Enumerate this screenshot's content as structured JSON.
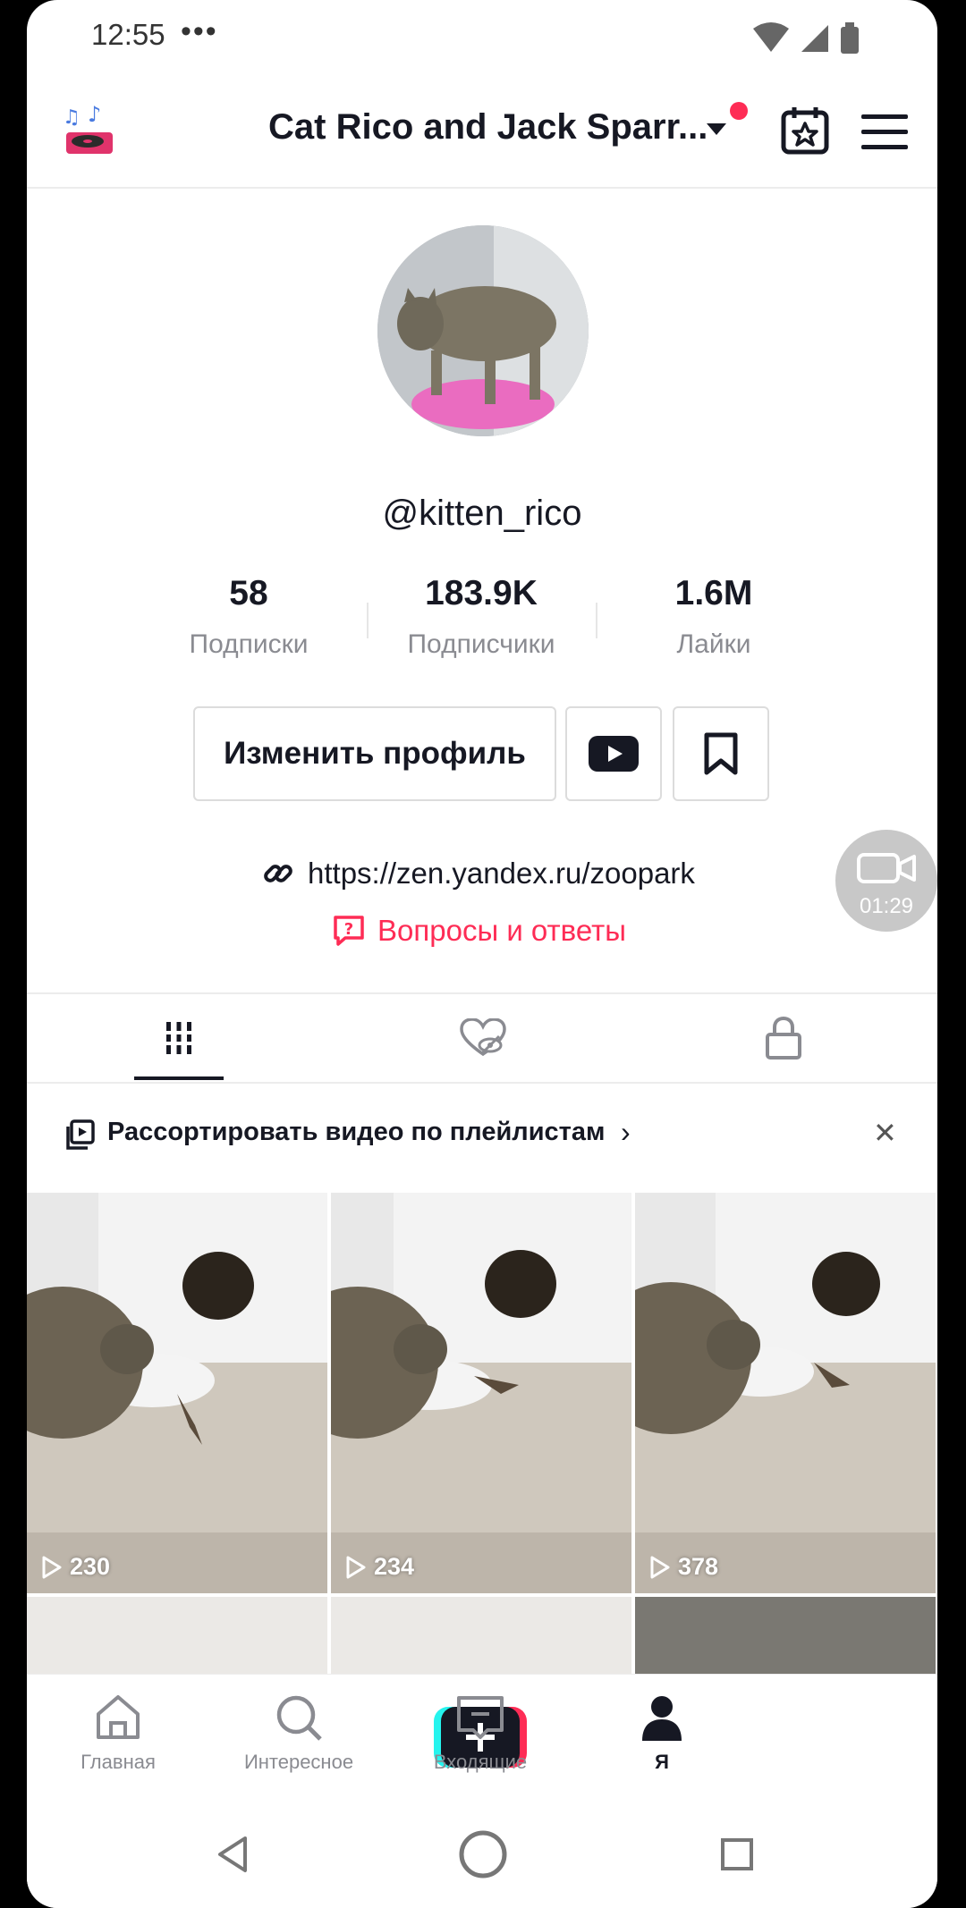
{
  "status_bar": {
    "time": "12:55",
    "dots": "•••"
  },
  "header": {
    "title": "Cat Rico and Jack Sparr...",
    "notification": true
  },
  "profile": {
    "username": "@kitten_rico",
    "stats": [
      {
        "value": "58",
        "label": "Подписки"
      },
      {
        "value": "183.9K",
        "label": "Подписчики"
      },
      {
        "value": "1.6M",
        "label": "Лайки"
      }
    ],
    "edit_button": "Изменить профиль",
    "link": "https://zen.yandex.ru/zoopark",
    "qa": "Вопросы и ответы"
  },
  "floating_recorder": {
    "time": "01:29"
  },
  "tabs": [
    {
      "icon": "grid-icon",
      "active": true
    },
    {
      "icon": "liked-hidden-icon",
      "active": false
    },
    {
      "icon": "lock-icon",
      "active": false
    }
  ],
  "playlist_banner": {
    "text": "Рассортировать видео по плейлистам"
  },
  "videos": [
    {
      "views": "230"
    },
    {
      "views": "234"
    },
    {
      "views": "378"
    }
  ],
  "bottom_nav": [
    {
      "label": "Главная",
      "icon": "home-icon"
    },
    {
      "label": "Интересное",
      "icon": "search-icon"
    },
    {
      "label": "Входящие",
      "icon": "inbox-icon"
    },
    {
      "label": "Я",
      "icon": "profile-icon"
    }
  ],
  "colors": {
    "accent": "#fe2c55",
    "text": "#161823",
    "muted": "#8a8b91"
  }
}
